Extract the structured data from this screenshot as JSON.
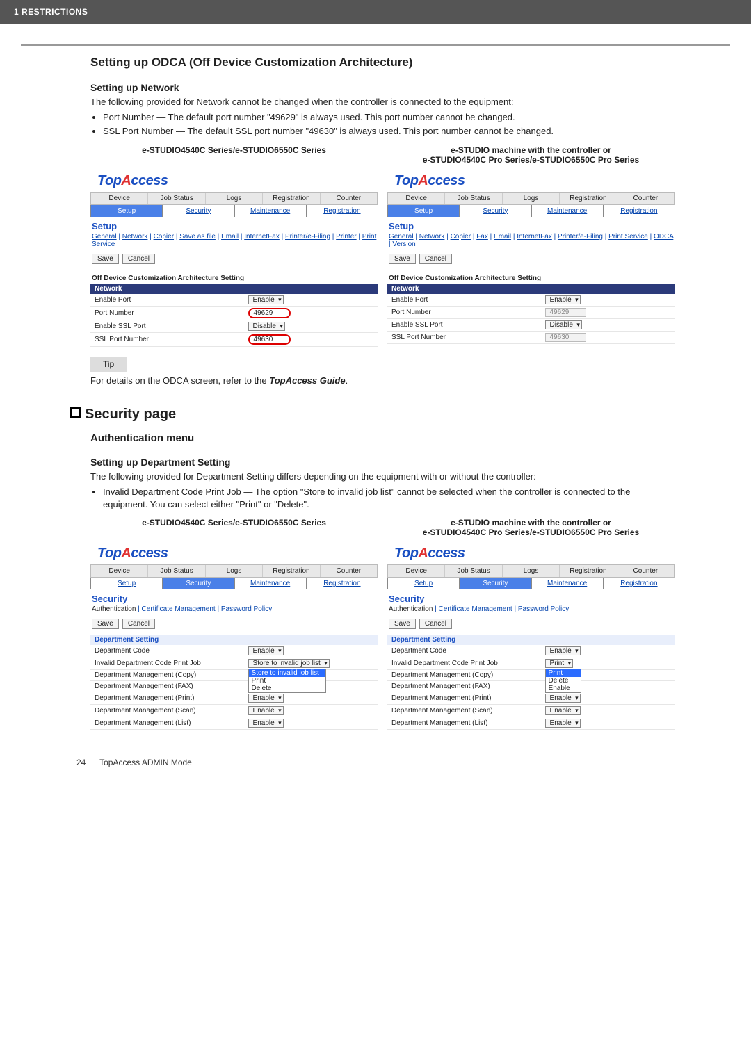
{
  "topbar": "1 RESTRICTIONS",
  "odca": {
    "heading": "Setting up ODCA (Off Device Customization Architecture)",
    "net_heading": "Setting up Network",
    "intro": "The following provided for Network cannot be changed when the controller is connected to the equipment:",
    "b1": "Port Number — The default port number \"49629\" is always used. This port number cannot be changed.",
    "b2": "SSL Port Number — The default SSL port number \"49630\" is always used. This port number cannot be changed.",
    "left_header": "e-STUDIO4540C Series/e-STUDIO6550C Series",
    "right_header_l1": "e-STUDIO machine with the controller or",
    "right_header_l2": "e-STUDIO4540C Pro Series/e-STUDIO6550C Pro Series",
    "logo_pre": "Top",
    "logo_lambda": "A",
    "logo_post": "ccess",
    "tabs": [
      "Device",
      "Job Status",
      "Logs",
      "Registration",
      "Counter"
    ],
    "subtabs": [
      "Setup",
      "Security",
      "Maintenance",
      "Registration"
    ],
    "page_label": "Setup",
    "links_left_a": "General",
    "links_left_b": "Network",
    "links_left_c": "Copier",
    "links_left_d": "Save as file",
    "links_left_e": "Email",
    "links_left_f": "InternetFax",
    "links_left_g": "Printer/e-Filing",
    "links_left_h": "Printer",
    "links_left_i": "Print Service",
    "links_right_a": "General",
    "links_right_b": "Network",
    "links_right_c": "Copier",
    "links_right_d": "Fax",
    "links_right_e": "Email",
    "links_right_f": "InternetFax",
    "links_right_g": "Printer/e-Filing",
    "links_right_h": "Print Service",
    "links_right_i": "ODCA",
    "links_right_j": "Version",
    "btn_save": "Save",
    "btn_cancel": "Cancel",
    "arch_heading": "Off Device Customization Architecture Setting",
    "band": "Network",
    "row1_k": "Enable Port",
    "row1_v": "Enable",
    "row2_k": "Port Number",
    "row2_v": "49629",
    "row3_k": "Enable SSL Port",
    "row3_v": "Disable",
    "row4_k": "SSL Port Number",
    "row4_v": "49630",
    "tip": "Tip",
    "tip_text_a": "For details on the ODCA screen, refer to the ",
    "tip_text_b": "TopAccess Guide",
    "tip_text_c": "."
  },
  "sec": {
    "heading": "Security page",
    "auth_heading": "Authentication menu",
    "dept_heading": "Setting up Department Setting",
    "intro": "The following provided for Department Setting differs depending on the equipment with or without the controller:",
    "b1": "Invalid Department Code Print Job — The option \"Store to invalid job list\" cannot be selected when the controller is connected to the equipment. You can select either \"Print\" or \"Delete\".",
    "left_header": "e-STUDIO4540C Series/e-STUDIO6550C Series",
    "right_header_l1": "e-STUDIO machine with the controller or",
    "right_header_l2": "e-STUDIO4540C Pro Series/e-STUDIO6550C Pro Series",
    "tabs": [
      "Device",
      "Job Status",
      "Logs",
      "Registration",
      "Counter"
    ],
    "subtabs": [
      "Setup",
      "Security",
      "Maintenance",
      "Registration"
    ],
    "page_label": "Security",
    "links_a": "Authentication",
    "links_b": "Certificate Management",
    "links_c": "Password Policy",
    "btn_save": "Save",
    "btn_cancel": "Cancel",
    "dept_band": "Department Setting",
    "r1_k": "Department Code",
    "r1_v": "Enable",
    "r2_k": "Invalid Department Code Print Job",
    "r2_left_v": "Store to invalid job list",
    "r2_right_v": "Print",
    "dd_opt1": "Store to invalid job list",
    "dd_opt2": "Print",
    "dd_opt3": "Delete",
    "dd_right_opt1": "Print",
    "dd_right_opt2": "Delete",
    "dd_right_opt3": "Enable",
    "r3_k": "Department Management (Copy)",
    "r4_k": "Department Management (FAX)",
    "r5_k": "Department Management (Print)",
    "r5_v": "Enable",
    "r6_k": "Department Management (Scan)",
    "r6_v": "Enable",
    "r7_k": "Department Management (List)",
    "r7_v": "Enable"
  },
  "footer": {
    "page": "24",
    "title": "TopAccess ADMIN Mode"
  }
}
